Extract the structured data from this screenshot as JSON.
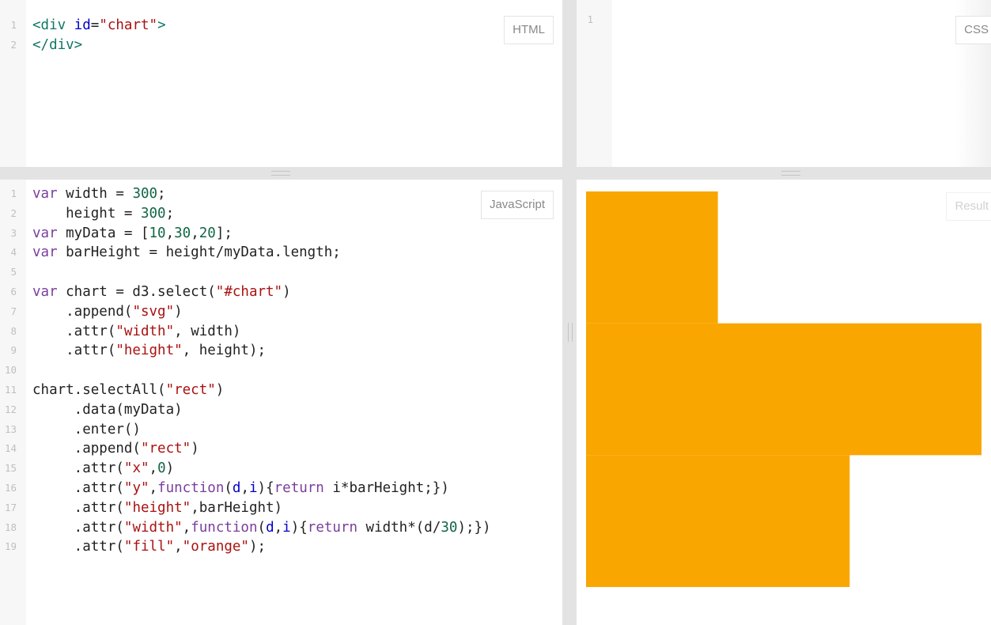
{
  "panels": {
    "html": {
      "label": "HTML",
      "lines": [
        {
          "num": "1",
          "parts": [
            [
              "tag",
              "<div "
            ],
            [
              "attr",
              "id"
            ],
            [
              "plain",
              "="
            ],
            [
              "str",
              "\"chart\""
            ],
            [
              "tag",
              ">"
            ]
          ]
        },
        {
          "num": "2",
          "parts": [
            [
              "tag",
              "</div>"
            ]
          ]
        }
      ]
    },
    "css": {
      "label": "CSS",
      "lines": [
        {
          "num": "1",
          "parts": []
        }
      ]
    },
    "javascript": {
      "label": "JavaScript",
      "lines": [
        {
          "num": "1",
          "parts": [
            [
              "kw",
              "var"
            ],
            [
              "plain",
              " width = "
            ],
            [
              "num",
              "300"
            ],
            [
              "plain",
              ";"
            ]
          ]
        },
        {
          "num": "2",
          "parts": [
            [
              "plain",
              "    height = "
            ],
            [
              "num",
              "300"
            ],
            [
              "plain",
              ";"
            ]
          ]
        },
        {
          "num": "3",
          "parts": [
            [
              "kw",
              "var"
            ],
            [
              "plain",
              " myData = ["
            ],
            [
              "num",
              "10"
            ],
            [
              "plain",
              ","
            ],
            [
              "num",
              "30"
            ],
            [
              "plain",
              ","
            ],
            [
              "num",
              "20"
            ],
            [
              "plain",
              "];"
            ]
          ]
        },
        {
          "num": "4",
          "parts": [
            [
              "kw",
              "var"
            ],
            [
              "plain",
              " barHeight = height/myData.length;"
            ]
          ]
        },
        {
          "num": "5",
          "parts": []
        },
        {
          "num": "6",
          "parts": [
            [
              "kw",
              "var"
            ],
            [
              "plain",
              " chart = d3.select("
            ],
            [
              "str",
              "\"#chart\""
            ],
            [
              "plain",
              ")"
            ]
          ]
        },
        {
          "num": "7",
          "parts": [
            [
              "plain",
              "    .append("
            ],
            [
              "str",
              "\"svg\""
            ],
            [
              "plain",
              ")"
            ]
          ]
        },
        {
          "num": "8",
          "parts": [
            [
              "plain",
              "    .attr("
            ],
            [
              "str",
              "\"width\""
            ],
            [
              "plain",
              ", width)"
            ]
          ]
        },
        {
          "num": "9",
          "parts": [
            [
              "plain",
              "    .attr("
            ],
            [
              "str",
              "\"height\""
            ],
            [
              "plain",
              ", height);"
            ]
          ]
        },
        {
          "num": "10",
          "parts": []
        },
        {
          "num": "11",
          "parts": [
            [
              "plain",
              "chart.selectAll("
            ],
            [
              "str",
              "\"rect\""
            ],
            [
              "plain",
              ")"
            ]
          ]
        },
        {
          "num": "12",
          "parts": [
            [
              "plain",
              "     .data(myData)"
            ]
          ]
        },
        {
          "num": "13",
          "parts": [
            [
              "plain",
              "     .enter()"
            ]
          ]
        },
        {
          "num": "14",
          "parts": [
            [
              "plain",
              "     .append("
            ],
            [
              "str",
              "\"rect\""
            ],
            [
              "plain",
              ")"
            ]
          ]
        },
        {
          "num": "15",
          "parts": [
            [
              "plain",
              "     .attr("
            ],
            [
              "str",
              "\"x\""
            ],
            [
              "plain",
              ","
            ],
            [
              "num",
              "0"
            ],
            [
              "plain",
              ")"
            ]
          ]
        },
        {
          "num": "16",
          "parts": [
            [
              "plain",
              "     .attr("
            ],
            [
              "str",
              "\"y\""
            ],
            [
              "plain",
              ","
            ],
            [
              "kw",
              "function"
            ],
            [
              "plain",
              "("
            ],
            [
              "var",
              "d"
            ],
            [
              "plain",
              ","
            ],
            [
              "var",
              "i"
            ],
            [
              "plain",
              "){"
            ],
            [
              "kw",
              "return"
            ],
            [
              "plain",
              " i*barHeight;})"
            ]
          ]
        },
        {
          "num": "17",
          "parts": [
            [
              "plain",
              "     .attr("
            ],
            [
              "str",
              "\"height\""
            ],
            [
              "plain",
              ",barHeight)"
            ]
          ]
        },
        {
          "num": "18",
          "parts": [
            [
              "plain",
              "     .attr("
            ],
            [
              "str",
              "\"width\""
            ],
            [
              "plain",
              ","
            ],
            [
              "kw",
              "function"
            ],
            [
              "plain",
              "("
            ],
            [
              "var",
              "d"
            ],
            [
              "plain",
              ","
            ],
            [
              "var",
              "i"
            ],
            [
              "plain",
              "){"
            ],
            [
              "kw",
              "return"
            ],
            [
              "plain",
              " width*(d/"
            ],
            [
              "num",
              "30"
            ],
            [
              "plain",
              ");})"
            ]
          ]
        },
        {
          "num": "19",
          "parts": [
            [
              "plain",
              "     .attr("
            ],
            [
              "str",
              "\"fill\""
            ],
            [
              "plain",
              ","
            ],
            [
              "str",
              "\"orange\""
            ],
            [
              "plain",
              ");"
            ]
          ]
        }
      ]
    },
    "result": {
      "label": "Result"
    }
  },
  "chart_data": {
    "type": "bar",
    "orientation": "horizontal",
    "values": [
      10,
      30,
      20
    ],
    "max": 30,
    "fill": "#f9a600"
  }
}
